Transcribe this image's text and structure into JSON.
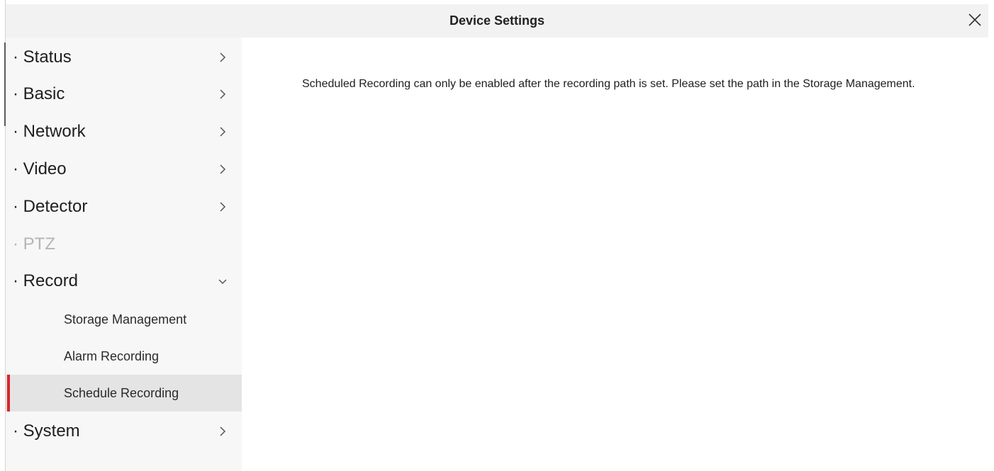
{
  "window": {
    "title": "Device Settings",
    "close_icon": "close-icon"
  },
  "sidebar": {
    "items": [
      {
        "label": "· Status",
        "icon": "chevron-right-icon",
        "enabled": true
      },
      {
        "label": "· Basic",
        "icon": "chevron-right-icon",
        "enabled": true
      },
      {
        "label": "· Network",
        "icon": "chevron-right-icon",
        "enabled": true
      },
      {
        "label": "· Video",
        "icon": "chevron-right-icon",
        "enabled": true
      },
      {
        "label": "· Detector",
        "icon": "chevron-right-icon",
        "enabled": true
      },
      {
        "label": "· PTZ",
        "enabled": false
      },
      {
        "label": "· Record",
        "icon": "chevron-down-icon",
        "enabled": true,
        "expanded": true
      },
      {
        "label": "· System",
        "icon": "chevron-right-icon",
        "enabled": true
      }
    ],
    "record_subitems": [
      {
        "label": "Storage Management",
        "active": false
      },
      {
        "label": "Alarm Recording",
        "active": false
      },
      {
        "label": "Schedule Recording",
        "active": true
      }
    ]
  },
  "content": {
    "message": "Scheduled Recording can only be enabled after the recording path is set. Please set the path in the Storage Management."
  },
  "colors": {
    "active_marker": "#d9262b",
    "active_background": "#e4e4e4",
    "titlebar_background": "#f2f2f2",
    "sidebar_background": "#f7f7f7",
    "disabled_text": "#b5b5b5"
  }
}
